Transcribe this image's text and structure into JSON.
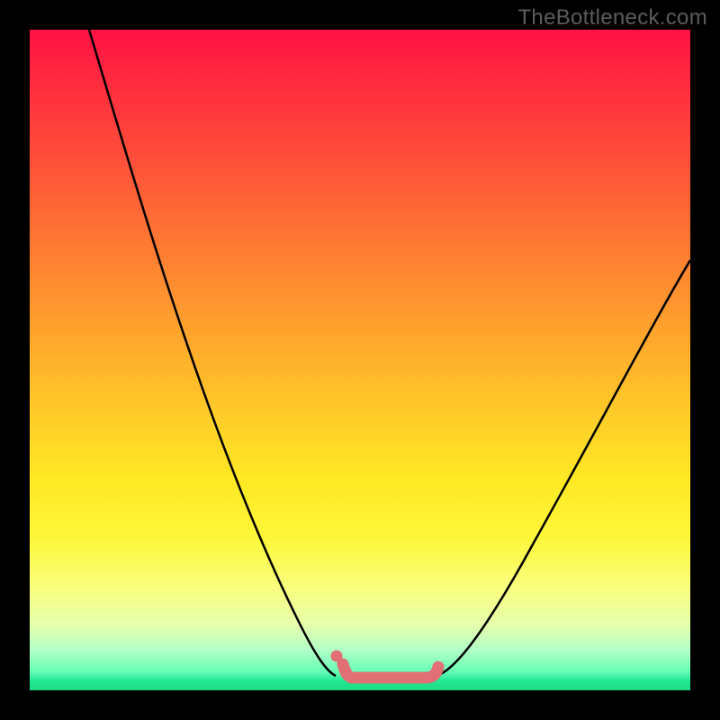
{
  "watermark": "TheBottleneck.com",
  "chart_data": {
    "type": "line",
    "title": "",
    "xlabel": "",
    "ylabel": "",
    "xlim": [
      0,
      100
    ],
    "ylim": [
      0,
      100
    ],
    "grid": false,
    "legend": false,
    "annotations": [
      "TheBottleneck.com"
    ],
    "background": {
      "type": "vertical-gradient",
      "stops": [
        {
          "pos": 0,
          "color": "#ff1244"
        },
        {
          "pos": 50,
          "color": "#ffb82a"
        },
        {
          "pos": 80,
          "color": "#fdf73a"
        },
        {
          "pos": 100,
          "color": "#1fe08b"
        }
      ],
      "meaning": "top=high bottleneck, bottom=optimal"
    },
    "series": [
      {
        "name": "bottleneck-curve",
        "color": "#000000",
        "x": [
          9,
          15,
          22,
          30,
          37,
          43,
          47,
          50,
          55,
          59,
          63,
          70,
          78,
          86,
          94,
          100
        ],
        "y": [
          100,
          80,
          62,
          44,
          28,
          14,
          5,
          2,
          2,
          2,
          5,
          14,
          30,
          47,
          60,
          65
        ]
      },
      {
        "name": "optimal-flat-region",
        "color": "#e26f73",
        "x": [
          47,
          50,
          55,
          59,
          62
        ],
        "y": [
          4,
          2,
          2,
          2,
          4
        ]
      }
    ],
    "markers": [
      {
        "name": "flat-start-dot",
        "x": 46.5,
        "y": 5,
        "color": "#e26f73"
      }
    ]
  }
}
